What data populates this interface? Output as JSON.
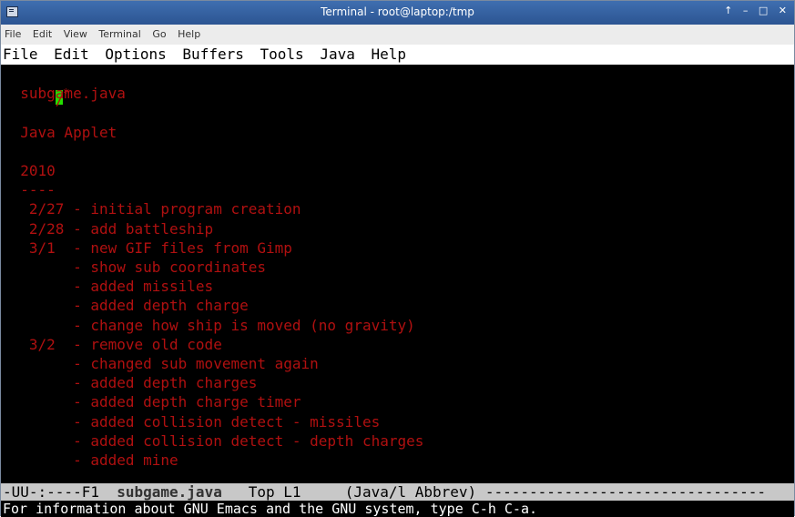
{
  "titlebar": {
    "title": "Terminal - root@laptop:/tmp",
    "controls": [
      "↑",
      "–",
      "□",
      "✕"
    ]
  },
  "terminal_menu": [
    "File",
    "Edit",
    "View",
    "Terminal",
    "Go",
    "Help"
  ],
  "emacs_menu": [
    "File",
    "Edit",
    "Options",
    "Buffers",
    "Tools",
    "Java",
    "Help"
  ],
  "buffer": {
    "first_line_rest": "*",
    "lines": [
      "",
      "  subgame.java",
      "",
      "  Java Applet",
      "",
      "  2010",
      "  ----",
      "   2/27 - initial program creation",
      "   2/28 - add battleship",
      "   3/1  - new GIF files from Gimp",
      "        - show sub coordinates",
      "        - added missiles",
      "        - added depth charge",
      "        - change how ship is moved (no gravity)",
      "   3/2  - remove old code",
      "        - changed sub movement again",
      "        - added depth charges",
      "        - added depth charge timer",
      "        - added collision detect - missiles",
      "        - added collision detect - depth charges",
      "        - added mine"
    ]
  },
  "modeline": {
    "prefix": "-UU-:----F1  ",
    "buffer_name": "subgame.java",
    "position": "   Top L1     ",
    "mode": "(Java/l Abbrev) ",
    "fill": "--------------------------------"
  },
  "minibuffer": "For information about GNU Emacs and the GNU system, type C-h C-a."
}
